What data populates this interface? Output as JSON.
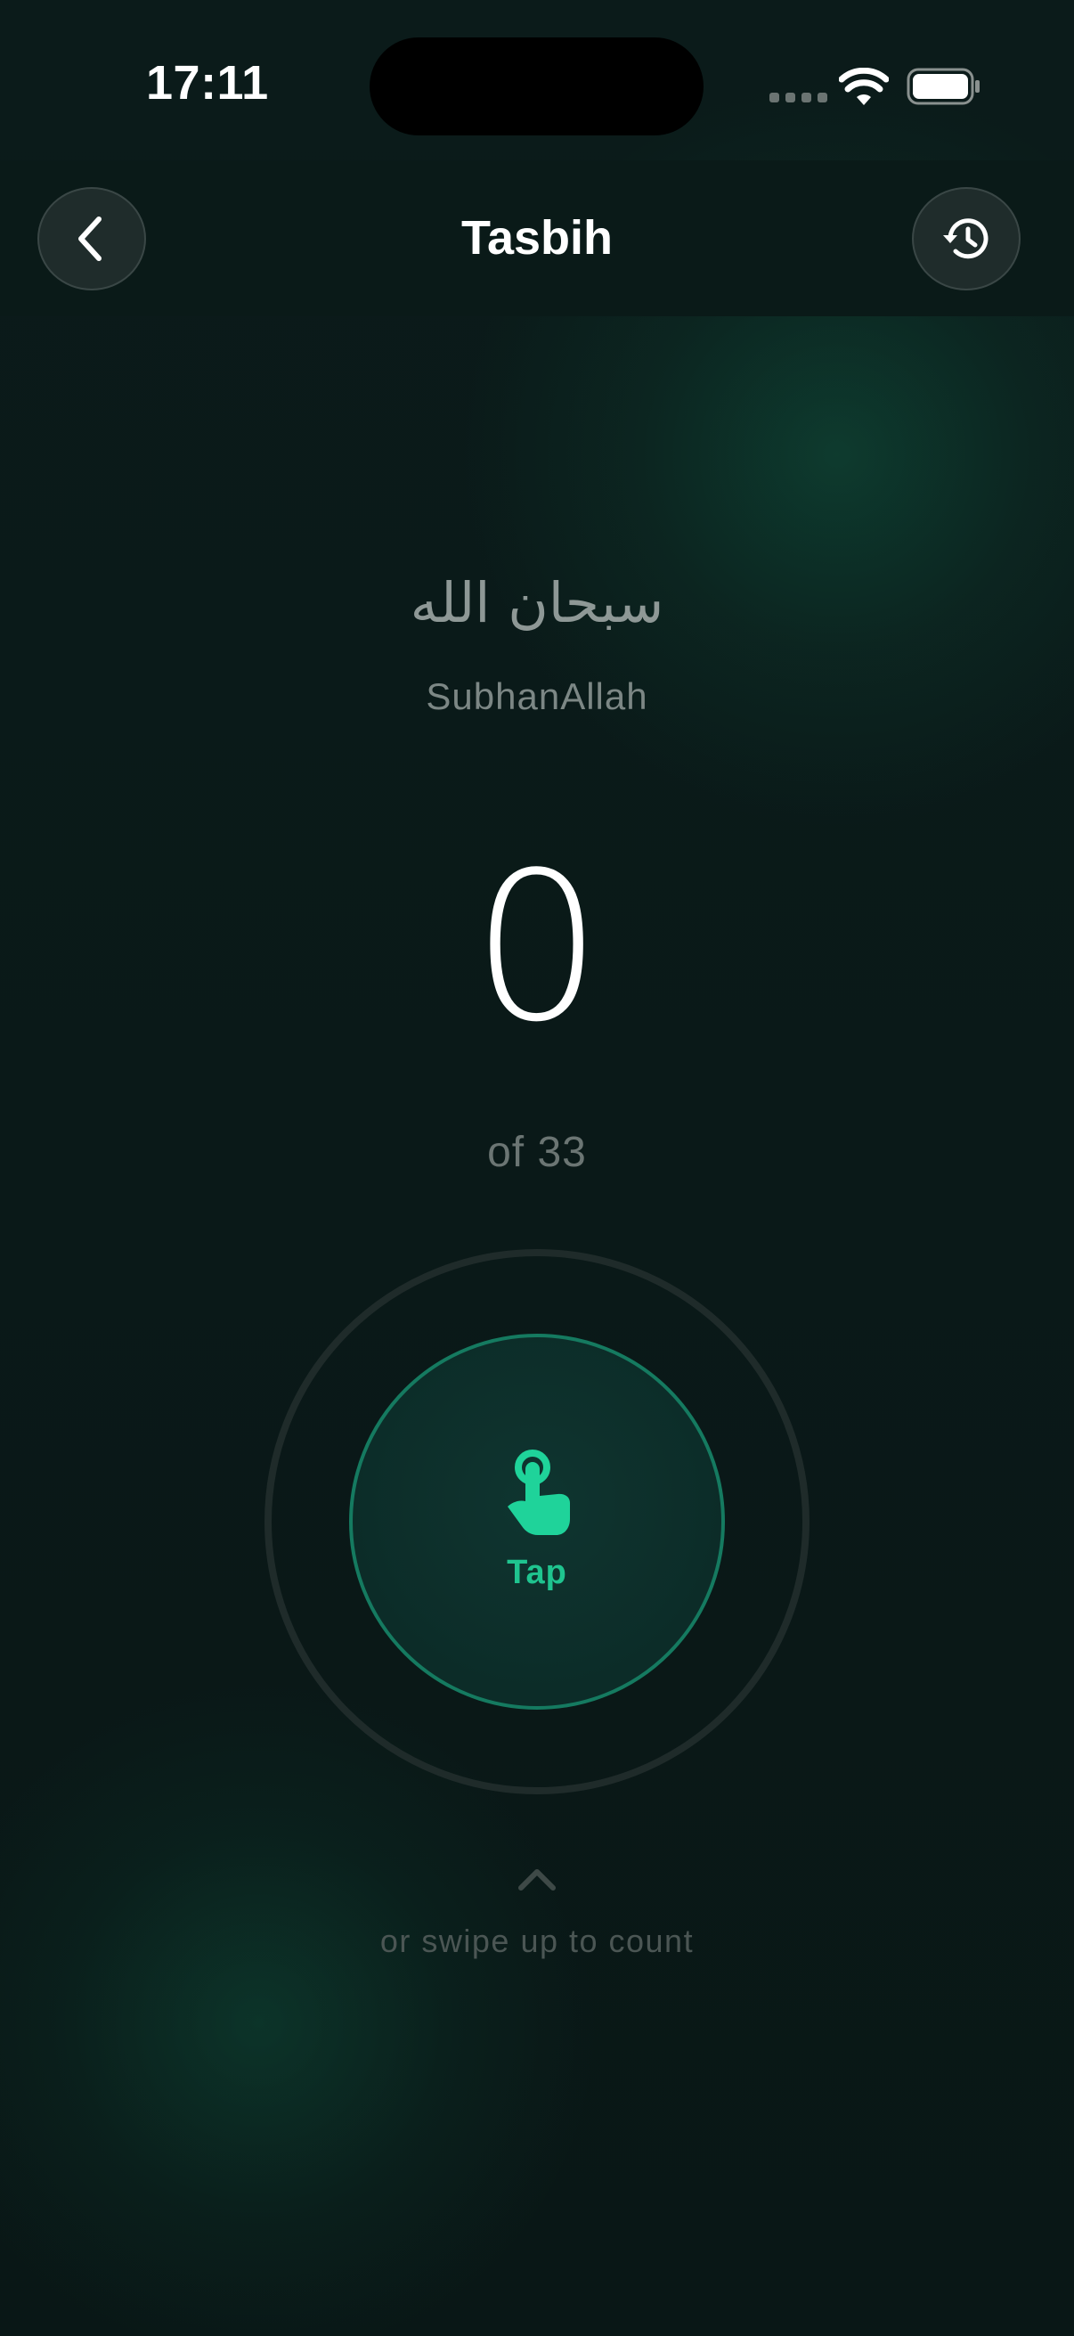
{
  "status_bar": {
    "time": "17:11"
  },
  "header": {
    "title": "Tasbih",
    "back_icon": "chevron-left-icon",
    "history_icon": "history-clock-icon"
  },
  "dhikr": {
    "arabic": "سبحان الله",
    "transliteration": "SubhanAllah"
  },
  "counter": {
    "count": "0",
    "target_text": "of 33"
  },
  "tap_button": {
    "icon": "tap-hand-icon",
    "label": "Tap"
  },
  "swipe_hint": {
    "icon": "chevron-up-icon",
    "text": "or swipe up to count"
  },
  "colors": {
    "background": "#0a1a19",
    "accent": "#1fc48f",
    "tap_ring": "#157a60"
  }
}
